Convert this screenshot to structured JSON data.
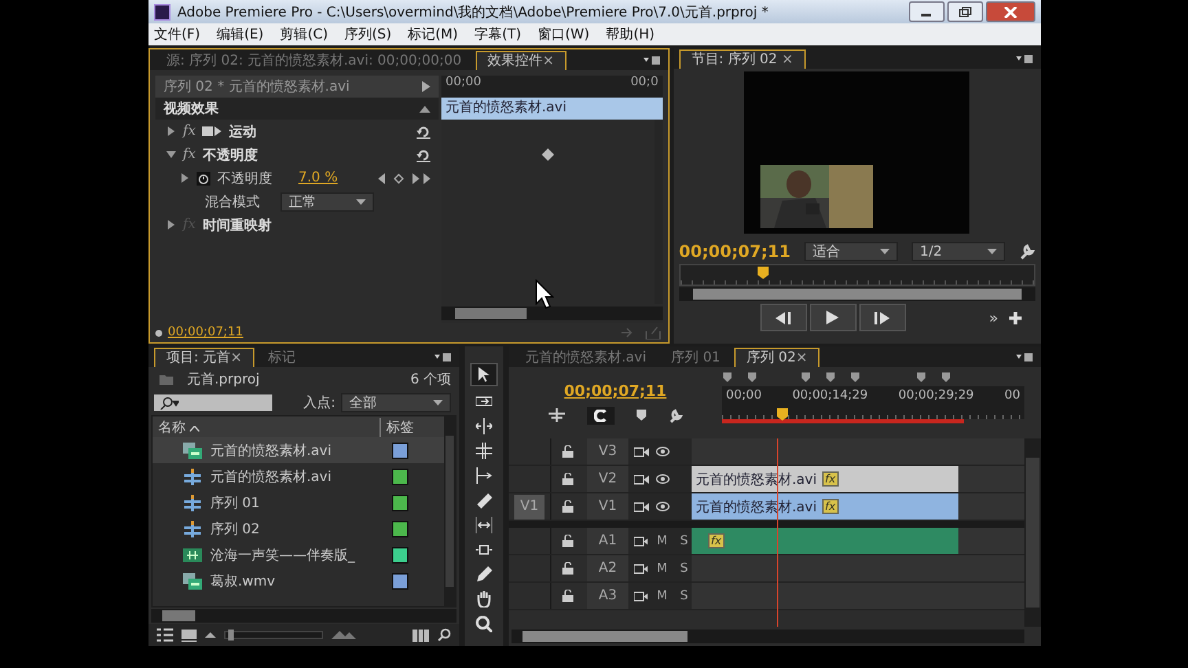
{
  "window": {
    "title": "Adobe Premiere Pro - C:\\Users\\overmind\\我的文档\\Adobe\\Premiere Pro\\7.0\\元首.prproj *"
  },
  "menu": [
    "文件(F)",
    "编辑(E)",
    "剪辑(C)",
    "序列(S)",
    "标记(M)",
    "字幕(T)",
    "窗口(W)",
    "帮助(H)"
  ],
  "source_panel": {
    "tabs": [
      {
        "label": "源: 序列 02: 元首的愤怒素材.avi: 00;00;00;00",
        "selected": false
      },
      {
        "label": "效果控件",
        "selected": true,
        "close": "×"
      }
    ]
  },
  "effect_controls": {
    "clip_label": "序列 02 * 元首的愤怒素材.avi",
    "ruler_start": "00;00",
    "ruler_end": "00;0",
    "clip_bar": "元首的愤怒素材.avi",
    "section": "视频效果",
    "effects": [
      {
        "kind": "motion",
        "badge": "fx",
        "name": "运动",
        "expanded": false,
        "fx_enabled": true
      },
      {
        "kind": "standard",
        "badge": "fx",
        "name": "不透明度",
        "expanded": true,
        "fx_enabled": true,
        "params": [
          {
            "kind": "value",
            "name": "不透明度",
            "value": "7.0 %",
            "keyframe": true
          },
          {
            "kind": "dropdown",
            "name": "混合模式",
            "value": "正常"
          }
        ]
      },
      {
        "kind": "standard",
        "badge": "fx",
        "name": "时间重映射",
        "expanded": false,
        "fx_enabled": false
      }
    ],
    "timecode": "00;00;07;11"
  },
  "program": {
    "tab": {
      "label": "节目: 序列 02",
      "close": "×"
    },
    "timecode": "00;00;07;11",
    "zoom": "适合",
    "resolution": "1/2",
    "more": "»",
    "scrub": {
      "level": 0.22
    }
  },
  "project": {
    "tabs": [
      {
        "label": "项目: 元首",
        "selected": true,
        "close": "×"
      },
      {
        "label": "标记",
        "selected": false
      }
    ],
    "file": "元首.prproj",
    "count": "6 个项",
    "in_label": "入点:",
    "in_value": "全部",
    "columns": [
      "名称",
      "标签"
    ],
    "items": [
      {
        "kind": "clip",
        "name": "元首的愤怒素材.avi",
        "color": "#7a9fd8",
        "selected": true
      },
      {
        "kind": "sequence",
        "name": "元首的愤怒素材.avi",
        "color": "#4cb84c",
        "selected": false
      },
      {
        "kind": "sequence",
        "name": "序列 01",
        "color": "#4cb84c",
        "selected": false
      },
      {
        "kind": "sequence",
        "name": "序列 02",
        "color": "#4cb84c",
        "selected": false
      },
      {
        "kind": "audio",
        "name": "沧海一声笑——伴奏版_",
        "color": "#3ccf8e",
        "selected": false
      },
      {
        "kind": "clip",
        "name": "葛叔.wmv",
        "color": "#7a9fd8",
        "selected": false
      }
    ],
    "zoom": {
      "level": 0.03
    }
  },
  "tools": [
    {
      "selected": true
    },
    {
      "selected": false
    },
    {
      "selected": false
    },
    {
      "selected": false
    },
    {
      "selected": false
    },
    {
      "selected": false
    },
    {
      "selected": false
    },
    {
      "selected": false
    },
    {
      "selected": false
    },
    {
      "selected": false
    },
    {
      "selected": false
    }
  ],
  "timeline": {
    "tabs": [
      {
        "label": "元首的愤怒素材.avi",
        "selected": false
      },
      {
        "label": "序列 01",
        "selected": false
      },
      {
        "label": "序列 02",
        "selected": true,
        "close": "×"
      }
    ],
    "timecode": "00;00;07;11",
    "ruler": [
      "00;00",
      "00;00;14;29",
      "00;00;29;29",
      "00"
    ],
    "playhead": {
      "level": 0.18
    },
    "video_tracks": [
      {
        "name": "V3"
      },
      {
        "name": "V2",
        "clip": {
          "label": "元首的愤怒素材.avi",
          "badge": "fx",
          "color": "#c9c9c9"
        }
      },
      {
        "name": "V1",
        "source": "V1",
        "clip": {
          "label": "元首的愤怒素材.avi",
          "badge": "fx",
          "color": "#8fb4e0"
        }
      }
    ],
    "audio_tracks": [
      {
        "name": "A1",
        "mute": "M",
        "solo": "S",
        "clip": {
          "badge": "fx",
          "color": "#2e8a62"
        }
      },
      {
        "name": "A2",
        "mute": "M",
        "solo": "S"
      },
      {
        "name": "A3",
        "mute": "M",
        "solo": "S"
      }
    ]
  }
}
